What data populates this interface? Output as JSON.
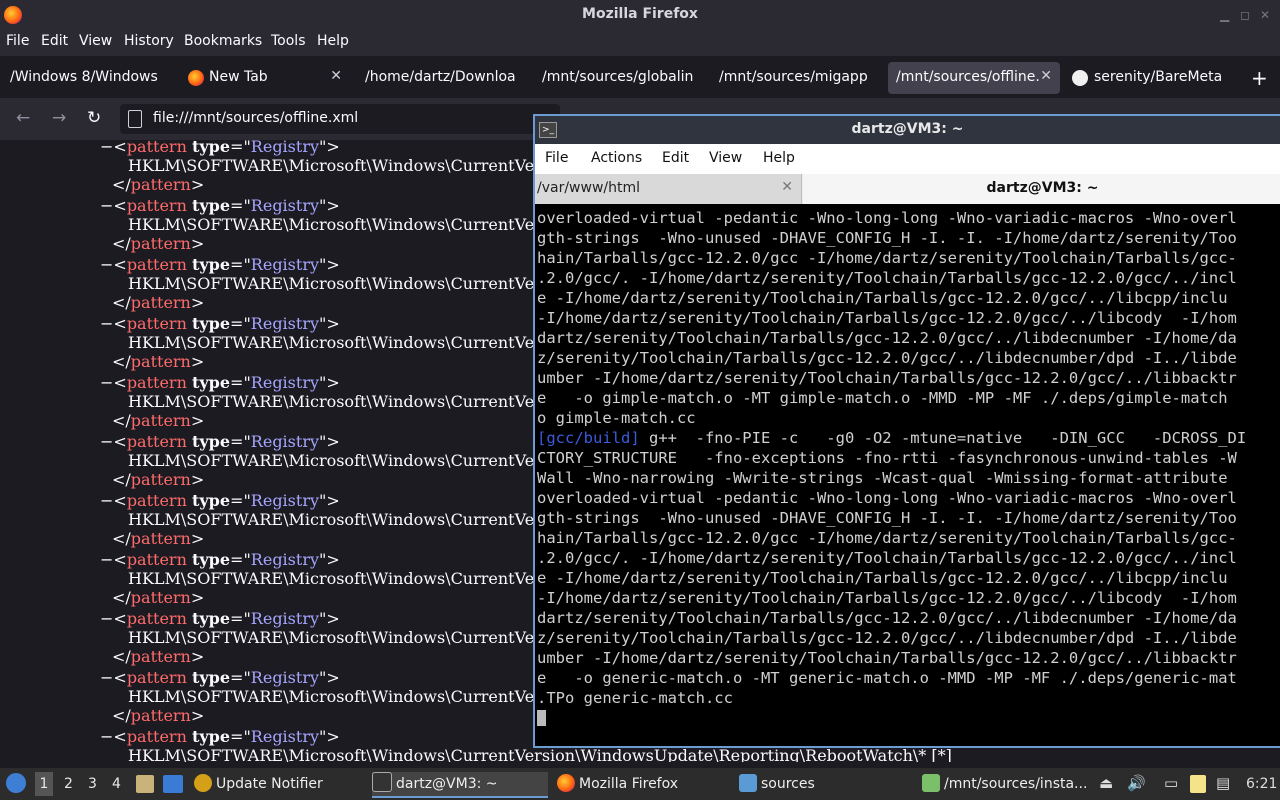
{
  "firefox": {
    "window_title": "Mozilla Firefox",
    "menu": [
      "File",
      "Edit",
      "View",
      "History",
      "Bookmarks",
      "Tools",
      "Help"
    ],
    "tabs": [
      {
        "label": "/Windows 8/Windows",
        "active": false
      },
      {
        "label": "New Tab",
        "active": false
      },
      {
        "label": "/home/dartz/Downloa",
        "active": false
      },
      {
        "label": "/mnt/sources/globalin",
        "active": false
      },
      {
        "label": "/mnt/sources/migapp",
        "active": false
      },
      {
        "label": "/mnt/sources/offline.",
        "active": true
      },
      {
        "label": "serenity/BareMeta",
        "active": false
      }
    ],
    "url": "file:///mnt/sources/offline.xml"
  },
  "xml": {
    "tag_name": "pattern",
    "attr_name": "type",
    "attr_value": "Registry",
    "path_visible": "HKLM\\SOFTWARE\\Microsoft\\Windows\\CurrentVe",
    "last_path": "HKLM\\SOFTWARE\\Microsoft\\Windows\\CurrentVersion\\WindowsUpdate\\Reporting\\RebootWatch\\* [*]"
  },
  "terminal": {
    "title": "dartz@VM3: ~",
    "menu": [
      "File",
      "Actions",
      "Edit",
      "View",
      "Help"
    ],
    "tab1": "/var/www/html",
    "tab2": "dartz@VM3: ~",
    "prefix": "[gcc/build]",
    "lines": [
      "overloaded-virtual -pedantic -Wno-long-long -Wno-variadic-macros -Wno-overl",
      "gth-strings  -Wno-unused -DHAVE_CONFIG_H -I. -I. -I/home/dartz/serenity/Too",
      "hain/Tarballs/gcc-12.2.0/gcc -I/home/dartz/serenity/Toolchain/Tarballs/gcc-",
      ".2.0/gcc/. -I/home/dartz/serenity/Toolchain/Tarballs/gcc-12.2.0/gcc/../incl",
      "e -I/home/dartz/serenity/Toolchain/Tarballs/gcc-12.2.0/gcc/../libcpp/inclu",
      "-I/home/dartz/serenity/Toolchain/Tarballs/gcc-12.2.0/gcc/../libcody  -I/hom",
      "dartz/serenity/Toolchain/Tarballs/gcc-12.2.0/gcc/../libdecnumber -I/home/da",
      "z/serenity/Toolchain/Tarballs/gcc-12.2.0/gcc/../libdecnumber/dpd -I../libde",
      "umber -I/home/dartz/serenity/Toolchain/Tarballs/gcc-12.2.0/gcc/../libbacktr",
      "e   -o gimple-match.o -MT gimple-match.o -MMD -MP -MF ./.deps/gimple-match",
      "o gimple-match.cc",
      " g++  -fno-PIE -c   -g0 -O2 -mtune=native   -DIN_GCC   -DCROSS_DI",
      "CTORY_STRUCTURE   -fno-exceptions -fno-rtti -fasynchronous-unwind-tables -W",
      "Wall -Wno-narrowing -Wwrite-strings -Wcast-qual -Wmissing-format-attribute",
      "overloaded-virtual -pedantic -Wno-long-long -Wno-variadic-macros -Wno-overl",
      "gth-strings  -Wno-unused -DHAVE_CONFIG_H -I. -I. -I/home/dartz/serenity/Too",
      "hain/Tarballs/gcc-12.2.0/gcc -I/home/dartz/serenity/Toolchain/Tarballs/gcc-",
      ".2.0/gcc/. -I/home/dartz/serenity/Toolchain/Tarballs/gcc-12.2.0/gcc/../incl",
      "e -I/home/dartz/serenity/Toolchain/Tarballs/gcc-12.2.0/gcc/../libcpp/inclu",
      "-I/home/dartz/serenity/Toolchain/Tarballs/gcc-12.2.0/gcc/../libcody  -I/hom",
      "dartz/serenity/Toolchain/Tarballs/gcc-12.2.0/gcc/../libdecnumber -I/home/da",
      "z/serenity/Toolchain/Tarballs/gcc-12.2.0/gcc/../libdecnumber/dpd -I../libde",
      "umber -I/home/dartz/serenity/Toolchain/Tarballs/gcc-12.2.0/gcc/../libbacktr",
      "e   -o generic-match.o -MT generic-match.o -MMD -MP -MF ./.deps/generic-mat",
      ".TPo generic-match.cc"
    ]
  },
  "taskbar": {
    "workspaces": [
      "1",
      "2",
      "3",
      "4"
    ],
    "tasks": [
      {
        "label": "Update Notifier",
        "icon": "update-notifier-icon"
      },
      {
        "label": "dartz@VM3: ~",
        "icon": "terminal-icon"
      },
      {
        "label": "Mozilla Firefox",
        "icon": "firefox-icon"
      },
      {
        "label": "sources",
        "icon": "folder-icon"
      },
      {
        "label": "/mnt/sources/insta...",
        "icon": "file-manager-icon"
      }
    ],
    "clock": "6:21"
  }
}
